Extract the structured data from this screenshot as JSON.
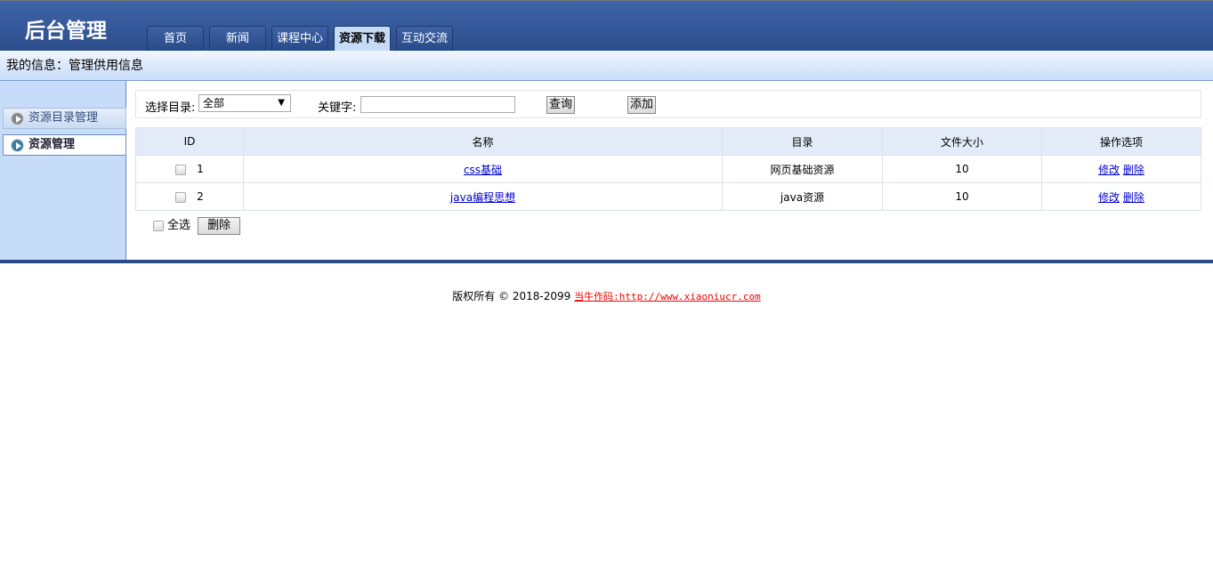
{
  "header": {
    "title": "后台管理",
    "tabs": [
      {
        "label": "首页"
      },
      {
        "label": "新闻"
      },
      {
        "label": "课程中心"
      },
      {
        "label": "资源下载"
      },
      {
        "label": "互动交流"
      }
    ]
  },
  "infobar": "我的信息：管理供用信息",
  "sidebar": {
    "items": [
      {
        "label": "资源目录管理"
      },
      {
        "label": "资源管理"
      }
    ]
  },
  "filter": {
    "dir_label": "选择目录:",
    "dir_value": "全部",
    "keyword_label": "关键字:",
    "keyword_value": "",
    "query": "查询",
    "add": "添加"
  },
  "table": {
    "headers": [
      "ID",
      "名称",
      "目录",
      "文件大小",
      "操作选项"
    ],
    "rows": [
      {
        "id": "1",
        "name": "css基础",
        "dir": "网页基础资源",
        "size": "10",
        "edit": "修改",
        "del": "删除"
      },
      {
        "id": "2",
        "name": "java编程思想",
        "dir": "java资源",
        "size": "10",
        "edit": "修改",
        "del": "删除"
      }
    ]
  },
  "bottom": {
    "select_all": "全选",
    "delete": "删除"
  },
  "footer": {
    "text": "版权所有 © 2018-2099",
    "link": "当牛作码:http://www.xiaoniucr.com"
  }
}
